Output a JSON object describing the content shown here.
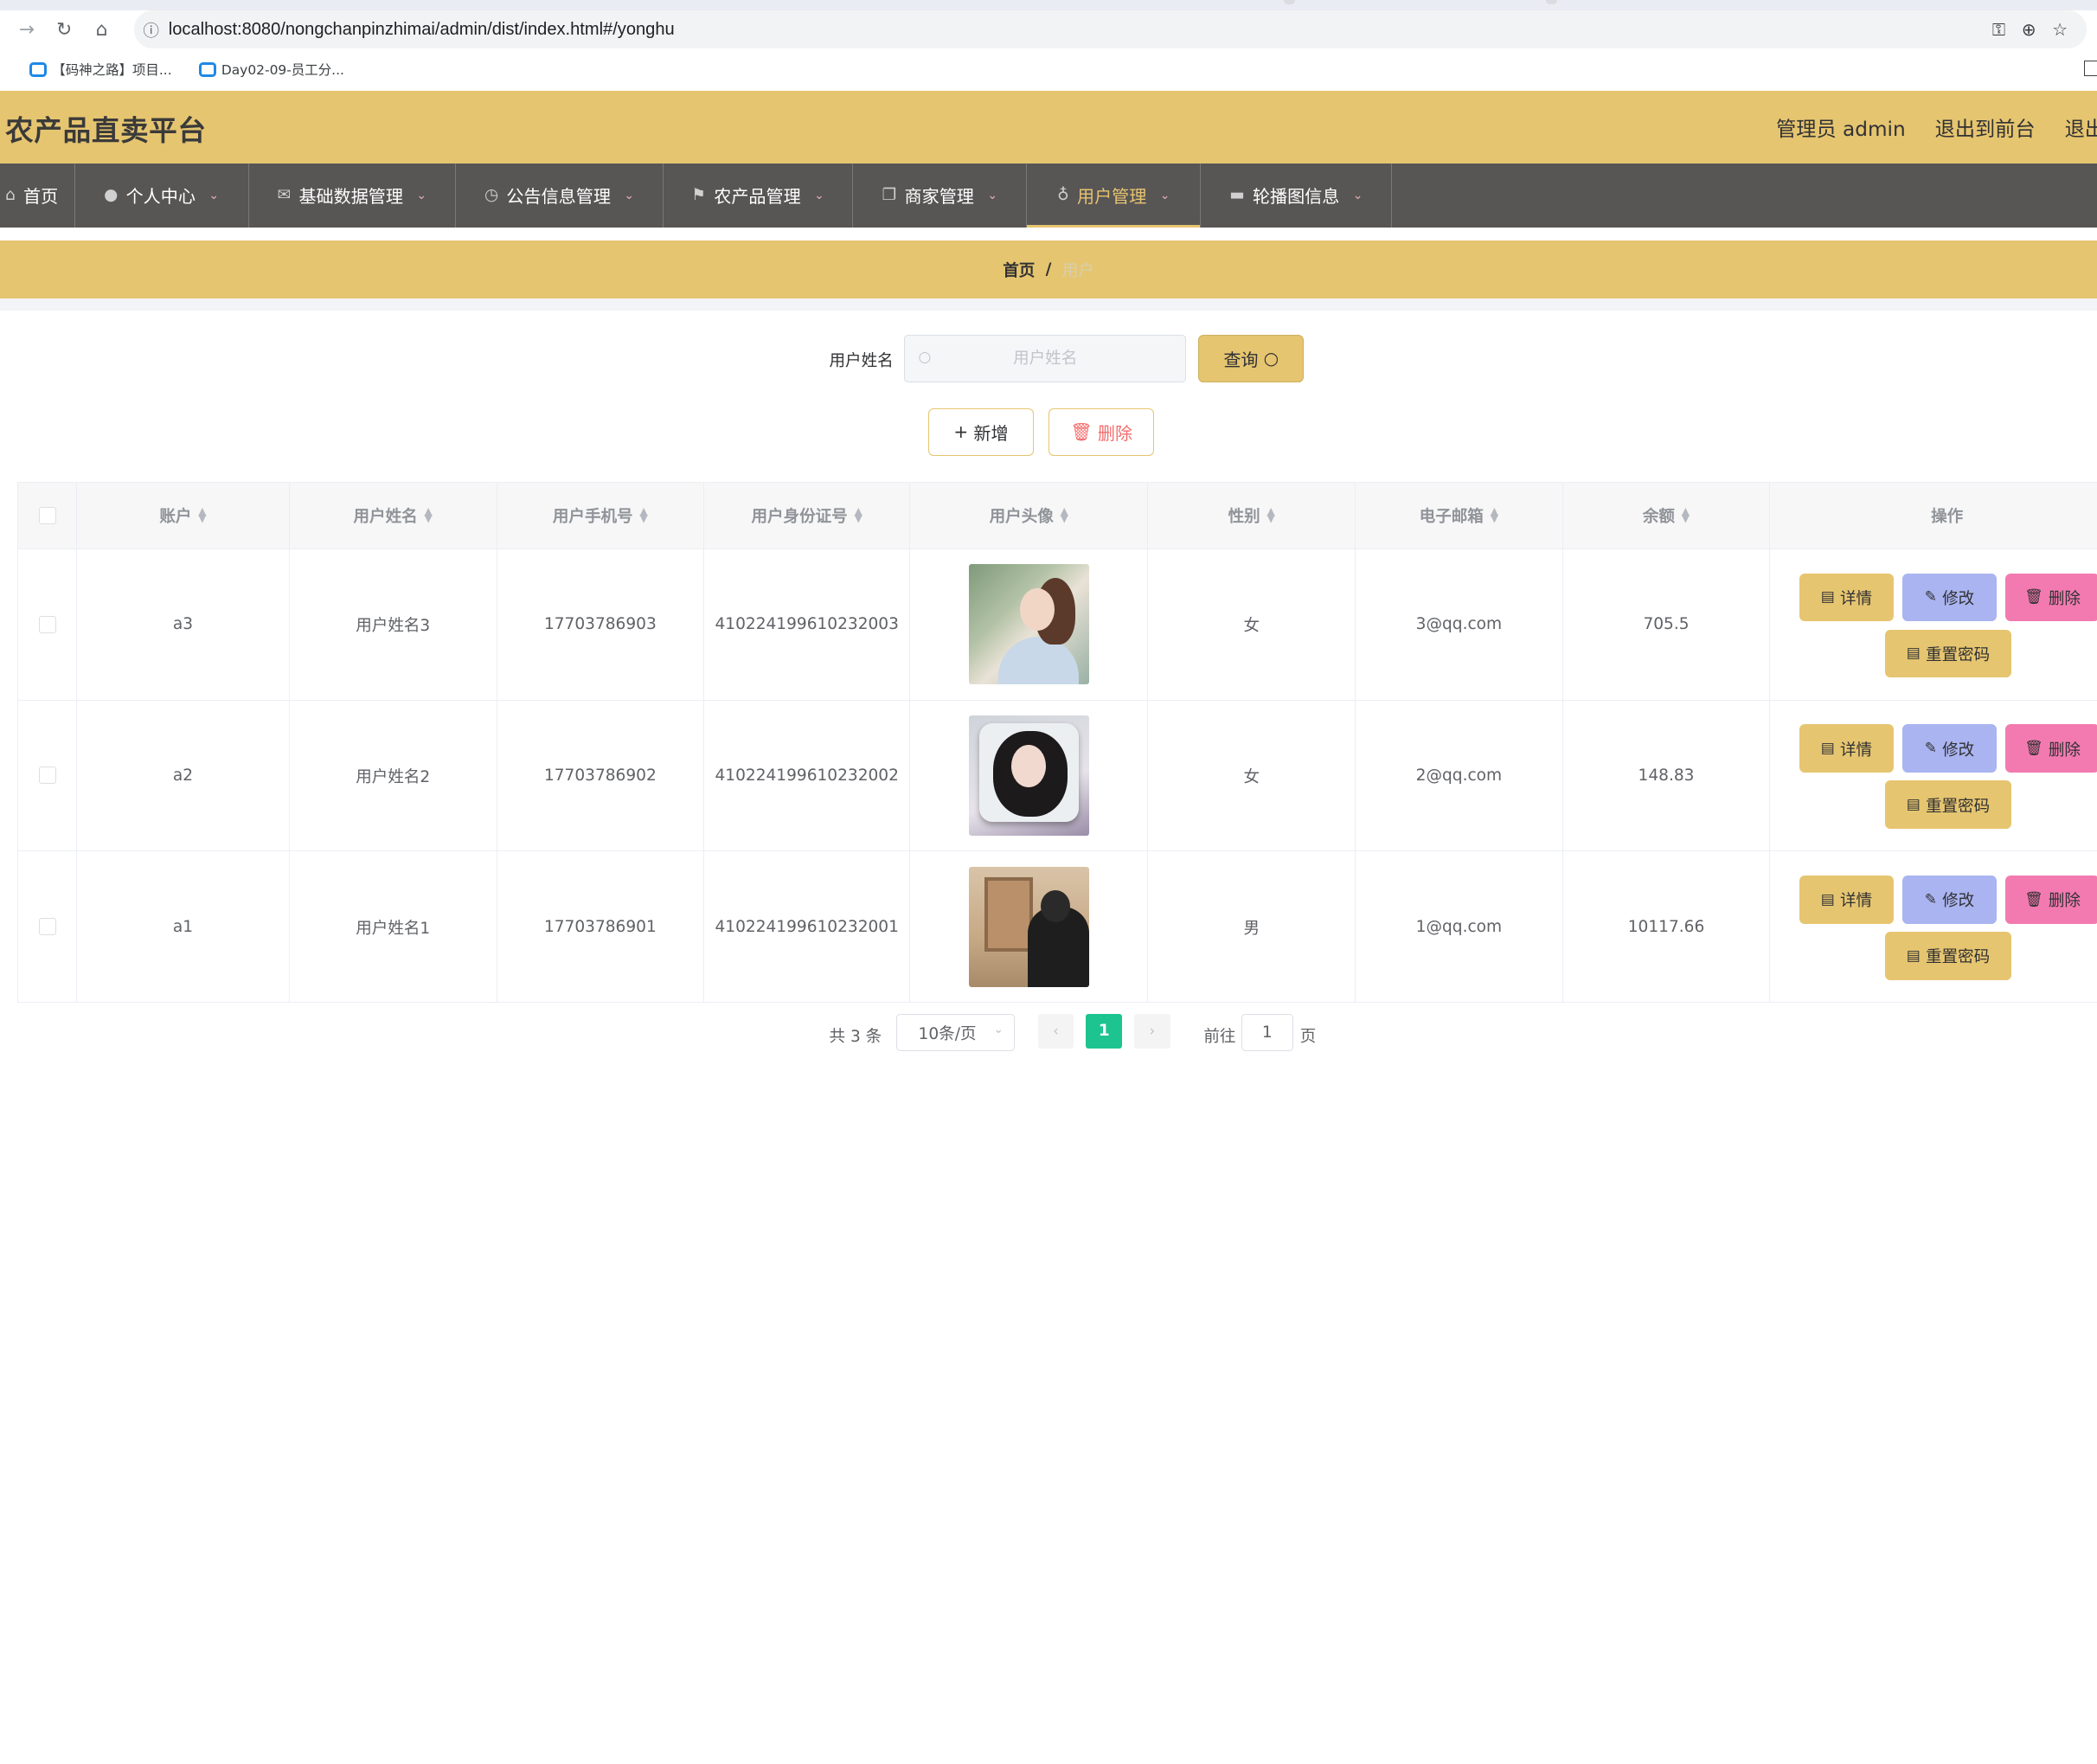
{
  "browser": {
    "url": "localhost:8080/nongchanpinzhimai/admin/dist/index.html#/yonghu",
    "bookmarks": [
      {
        "label": "【码神之路】项目..."
      },
      {
        "label": "Day02-09-员工分..."
      }
    ],
    "icons": [
      "back-icon",
      "reload-icon",
      "home-icon",
      "site-info-icon",
      "password-key-icon",
      "zoom-icon",
      "star-icon"
    ]
  },
  "header": {
    "title": "农产品直卖平台",
    "links": [
      "管理员 admin",
      "退出到前台",
      "退出登录"
    ],
    "bg_color": "#e6c570"
  },
  "nav": {
    "items": [
      {
        "label": "首页",
        "icon": "home-icon",
        "dropdown": false
      },
      {
        "label": "个人中心",
        "icon": "user-icon",
        "dropdown": true
      },
      {
        "label": "基础数据管理",
        "icon": "mail-icon",
        "dropdown": true
      },
      {
        "label": "公告信息管理",
        "icon": "clock-icon",
        "dropdown": true
      },
      {
        "label": "农产品管理",
        "icon": "flag-icon",
        "dropdown": true
      },
      {
        "label": "商家管理",
        "icon": "copy-icon",
        "dropdown": true
      },
      {
        "label": "用户管理",
        "icon": "microphone-icon",
        "dropdown": true,
        "active": true
      },
      {
        "label": "轮播图信息",
        "icon": "monitor-icon",
        "dropdown": true
      }
    ],
    "bg_color": "#585555",
    "active_color": "#e6c570"
  },
  "breadcrumb": {
    "home": "首页",
    "separator": "/",
    "current": "用户"
  },
  "search": {
    "label": "用户姓名",
    "placeholder": "用户姓名",
    "value": "",
    "query_button": "查询"
  },
  "actions": {
    "add": "新增",
    "delete": "删除"
  },
  "table": {
    "columns": [
      "账户",
      "用户姓名",
      "用户手机号",
      "用户身份证号",
      "用户头像",
      "性别",
      "电子邮箱",
      "余额",
      "操作"
    ],
    "rows": [
      {
        "account": "a3",
        "name": "用户姓名3",
        "phone": "17703786903",
        "id_card": "410224199610232003",
        "avatar": "avatar-photo-woman-ponytail",
        "gender": "女",
        "email": "3@qq.com",
        "balance": "705.5"
      },
      {
        "account": "a2",
        "name": "用户姓名2",
        "phone": "17703786902",
        "id_card": "410224199610232002",
        "avatar": "avatar-photo-woman-pillow",
        "gender": "女",
        "email": "2@qq.com",
        "balance": "148.83"
      },
      {
        "account": "a1",
        "name": "用户姓名1",
        "phone": "17703786901",
        "id_card": "410224199610232001",
        "avatar": "avatar-photo-man-back",
        "gender": "男",
        "email": "1@qq.com",
        "balance": "10117.66"
      }
    ],
    "row_actions": {
      "detail": "详情",
      "edit": "修改",
      "delete": "删除",
      "reset_password": "重置密码"
    },
    "action_colors": {
      "detail": "#e6c570",
      "edit": "#aab4f0",
      "delete": "#f37ab0",
      "reset_password": "#e6c570"
    }
  },
  "pagination": {
    "total": "共 3 条",
    "page_size": "10条/页",
    "current_page": "1",
    "goto_label": "前往",
    "goto_value": "1",
    "page_suffix": "页",
    "active_color": "#1ec48f"
  }
}
